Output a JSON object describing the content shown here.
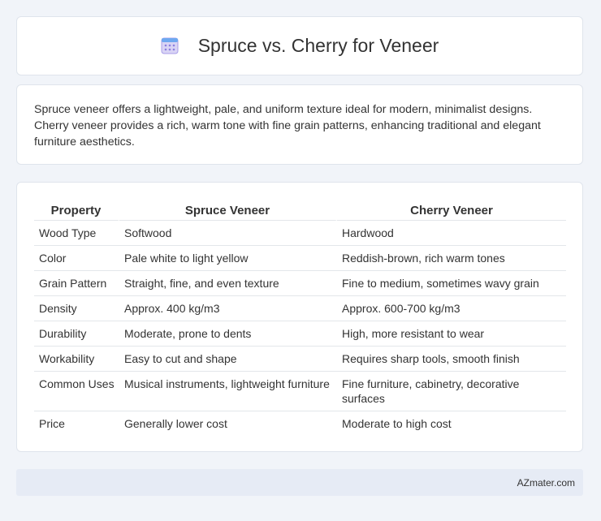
{
  "header": {
    "title": "Spruce vs. Cherry for Veneer",
    "icon": "calendar-icon"
  },
  "summary": {
    "text": "Spruce veneer offers a lightweight, pale, and uniform texture ideal for modern, minimalist designs. Cherry veneer provides a rich, warm tone with fine grain patterns, enhancing traditional and elegant furniture aesthetics."
  },
  "table": {
    "headers": [
      "Property",
      "Spruce Veneer",
      "Cherry Veneer"
    ],
    "rows": [
      [
        "Wood Type",
        "Softwood",
        "Hardwood"
      ],
      [
        "Color",
        "Pale white to light yellow",
        "Reddish-brown, rich warm tones"
      ],
      [
        "Grain Pattern",
        "Straight, fine, and even texture",
        "Fine to medium, sometimes wavy grain"
      ],
      [
        "Density",
        "Approx. 400 kg/m3",
        "Approx. 600-700 kg/m3"
      ],
      [
        "Durability",
        "Moderate, prone to dents",
        "High, more resistant to wear"
      ],
      [
        "Workability",
        "Easy to cut and shape",
        "Requires sharp tools, smooth finish"
      ],
      [
        "Common Uses",
        "Musical instruments, lightweight furniture",
        "Fine furniture, cabinetry, decorative surfaces"
      ],
      [
        "Price",
        "Generally lower cost",
        "Moderate to high cost"
      ]
    ]
  },
  "footer": {
    "brand": "AZmater.com"
  }
}
